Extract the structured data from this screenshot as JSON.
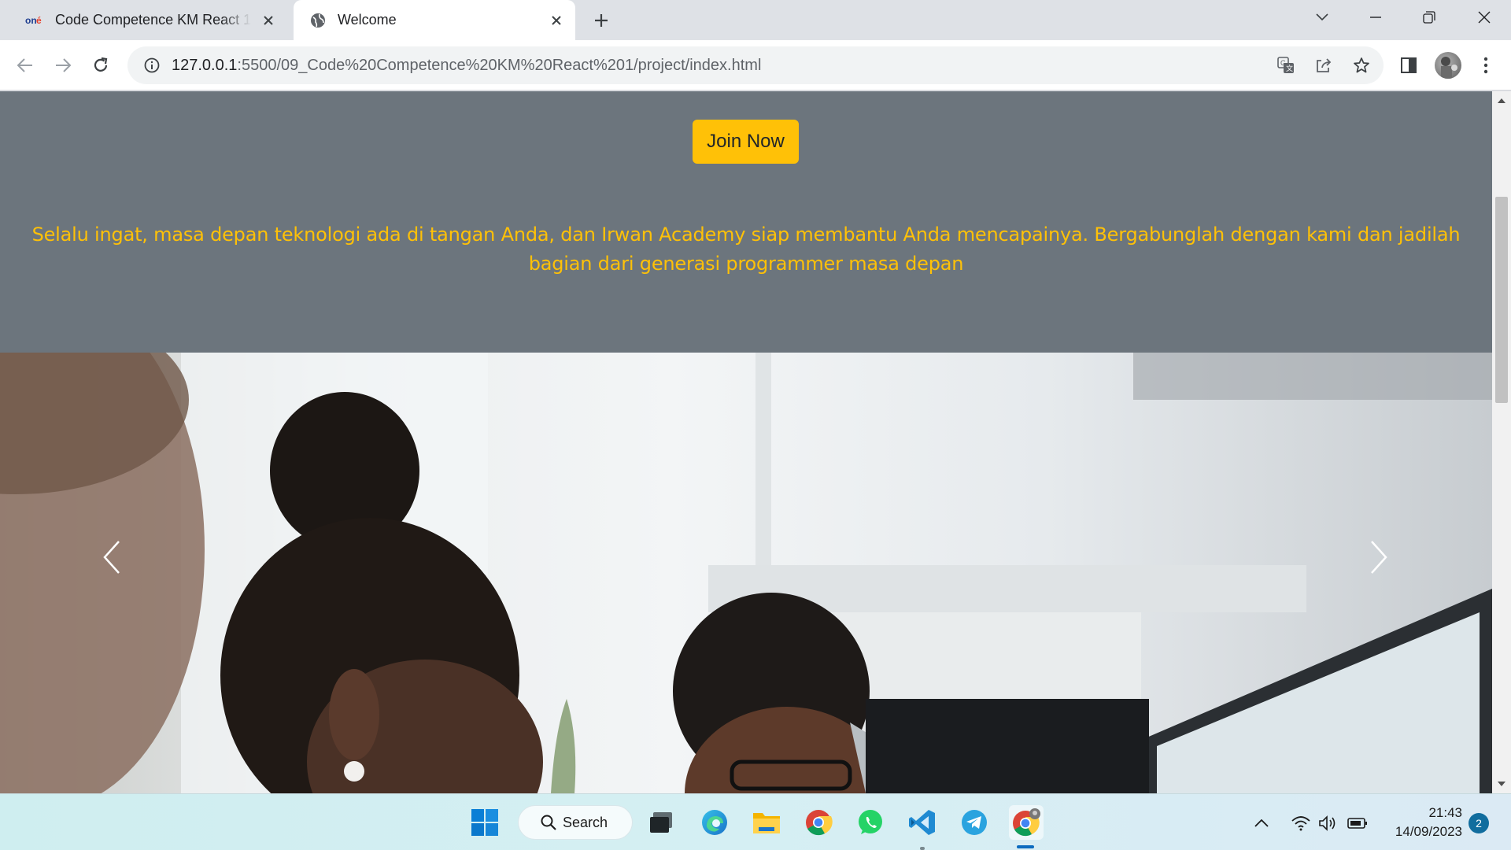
{
  "browser": {
    "tabs": [
      {
        "title": "Code Competence KM React 1 –",
        "favicon": "one-logo-icon"
      },
      {
        "title": "Welcome",
        "favicon": "globe-icon"
      }
    ],
    "url_host": "127.0.0.1",
    "url_rest": ":5500/09_Code%20Competence%20KM%20React%201/project/index.html"
  },
  "page": {
    "join_button": "Join Now",
    "tagline": "Selalu ingat, masa depan teknologi ada di tangan Anda, dan Irwan Academy siap membantu Anda mencapainya. Bergabunglah dengan kami dan jadilah bagian dari generasi programmer masa depan",
    "colors": {
      "accent": "#ffc107",
      "section_bg": "#6c757d"
    }
  },
  "taskbar": {
    "search_label": "Search",
    "apps": [
      "windows-start-icon",
      "search-icon",
      "task-view-icon",
      "edge-icon",
      "file-explorer-icon",
      "chrome-icon",
      "whatsapp-icon",
      "vscode-icon",
      "telegram-icon",
      "chrome-profile-icon"
    ],
    "time": "21:43",
    "date": "14/09/2023",
    "notifications": "2"
  }
}
